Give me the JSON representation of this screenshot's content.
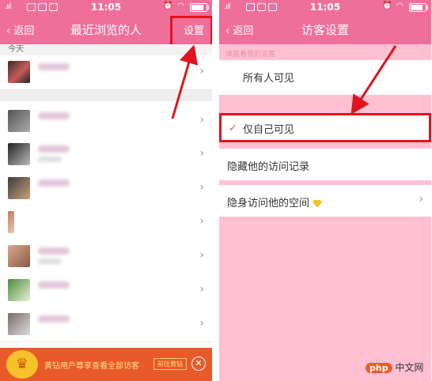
{
  "left": {
    "status": {
      "signal": ".ııl",
      "time": "11:05"
    },
    "nav": {
      "back": "‹ 返回",
      "title": "最近浏览的人",
      "settings": "设置"
    },
    "section_today": "今天",
    "rows": [
      {
        "chev": "›"
      },
      {
        "chev": "›"
      },
      {
        "chev": "›"
      },
      {
        "chev": "›"
      },
      {
        "chev": "›"
      },
      {
        "chev": "›"
      },
      {
        "chev": "›"
      },
      {
        "chev": "›"
      }
    ],
    "banner": {
      "text": "黄钻用户尊享查看全部访客",
      "button": "前往黄钻",
      "close": "✕"
    }
  },
  "right": {
    "status": {
      "signal": ".ııl",
      "time": "11:05"
    },
    "nav": {
      "back": "‹ 返回",
      "title": "访客设置"
    },
    "hint": "谁能看我的访客",
    "options": {
      "all": "所有人可见",
      "self": "仅自己可见",
      "check": "✓"
    },
    "hide_records": "隐藏他的访问记录",
    "hide_visit": "隐身访问他的空间",
    "chev": "›"
  },
  "watermark": {
    "logo": "php",
    "text": "中文网"
  },
  "colors": {
    "accent": "#ef6f9b",
    "highlight": "#e0141e",
    "bg_pink": "#ffc0d3"
  }
}
